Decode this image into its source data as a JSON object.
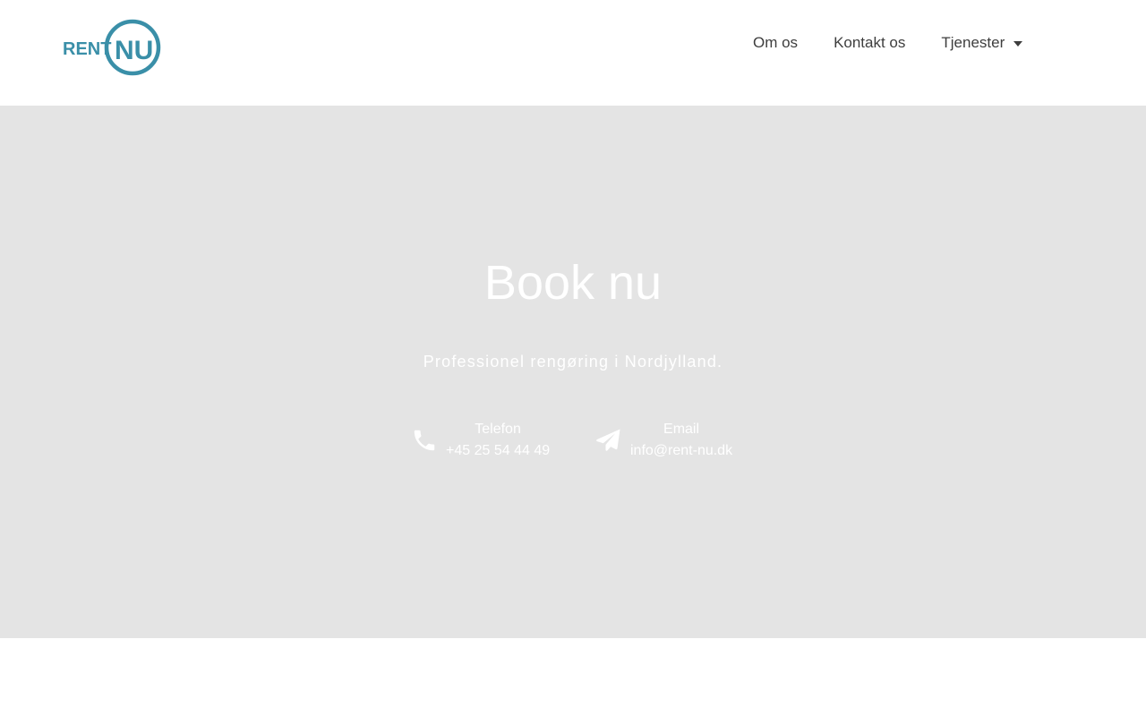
{
  "brand": {
    "logo_text_left": "RENT",
    "logo_text_right": "NU",
    "logo_color": "#3a8fa8"
  },
  "nav": {
    "items": [
      {
        "label": "Om os"
      },
      {
        "label": "Kontakt os"
      },
      {
        "label": "Tjenester",
        "has_dropdown": true
      }
    ]
  },
  "hero": {
    "background": "#e4e4e4",
    "title": "Book nu",
    "subtitle": "Professionel rengøring i Nordjylland.",
    "contacts": [
      {
        "icon": "phone-icon",
        "label": "Telefon",
        "value": "+45 25 54 44 49"
      },
      {
        "icon": "paper-plane-icon",
        "label": "Email",
        "value": "info@rent-nu.dk"
      }
    ]
  }
}
